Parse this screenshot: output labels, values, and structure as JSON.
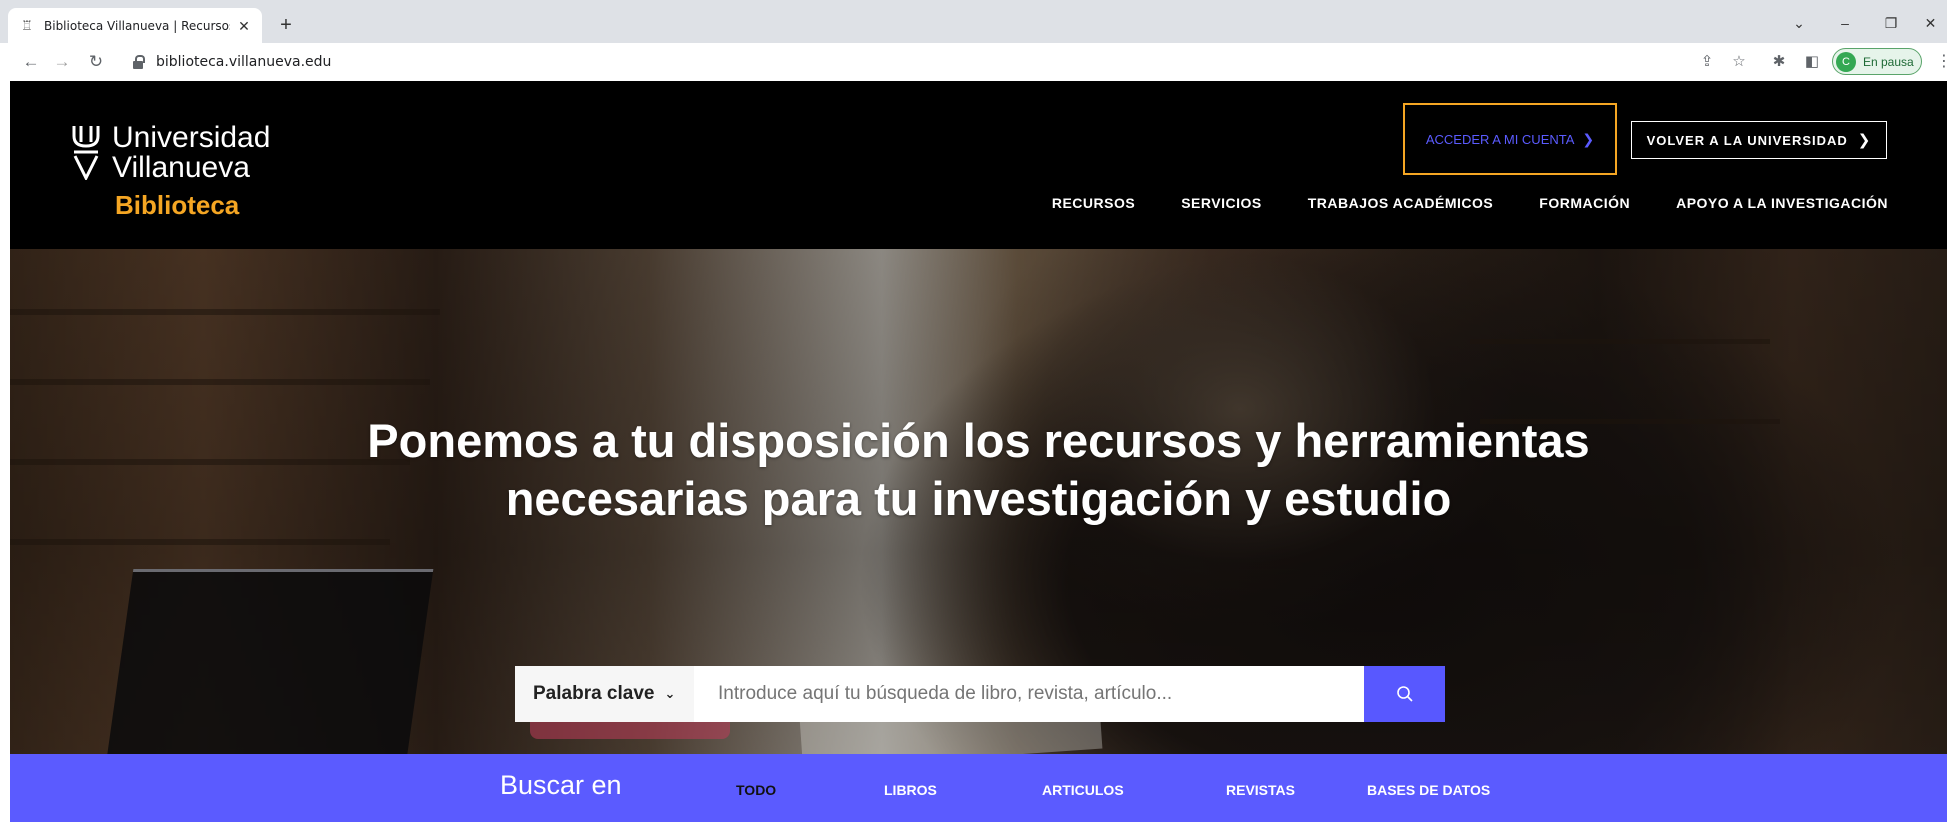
{
  "browser": {
    "tab_title": "Biblioteca Villanueva | Recursos y",
    "url": "biblioteca.villanueva.edu",
    "profile_initial": "C",
    "profile_label": "En pausa",
    "favicon": "library-favicon-icon"
  },
  "header": {
    "logo_line1": "Universidad",
    "logo_line2": "Villanueva",
    "logo_line3": "Biblioteca",
    "account_button": "ACCEDER A MI CUENTA",
    "university_button": "VOLVER A LA UNIVERSIDAD",
    "nav": [
      "RECURSOS",
      "SERVICIOS",
      "TRABAJOS ACADÉMICOS",
      "FORMACIÓN",
      "APOYO A LA INVESTIGACIÓN"
    ],
    "accent_color": "#f5a623",
    "brand_blue": "#5b5bff"
  },
  "hero": {
    "title_line1": "Ponemos a tu disposición los recursos y herramientas",
    "title_line2": "necesarias para tu investigación y estudio",
    "search_type": "Palabra clave",
    "search_placeholder": "Introduce aquí tu búsqueda de libro, revista, artículo..."
  },
  "buscar": {
    "label": "Buscar en",
    "tabs": [
      "TODO",
      "LIBROS",
      "ARTICULOS",
      "REVISTAS",
      "BASES DE DATOS"
    ],
    "active_tab": "TODO"
  }
}
